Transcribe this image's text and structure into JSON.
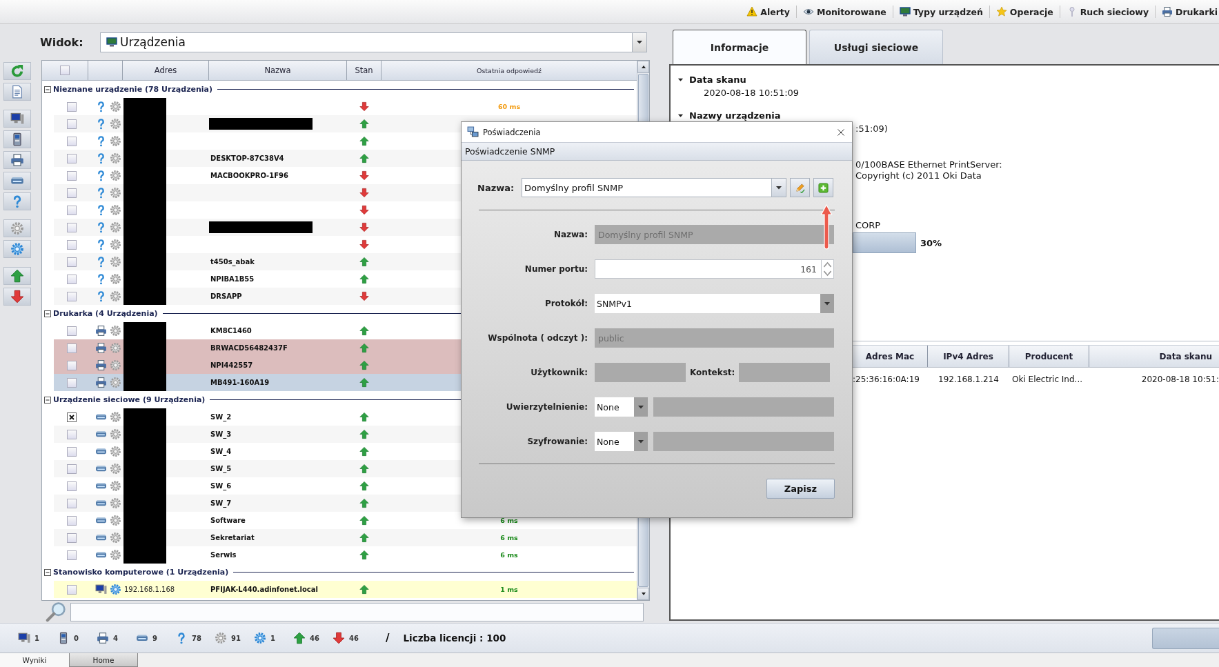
{
  "menu": [
    {
      "kind": "alerts",
      "label": "Alerty"
    },
    {
      "kind": "monitored",
      "label": "Monitorowane"
    },
    {
      "kind": "device_types",
      "label": "Typy urządzeń"
    },
    {
      "kind": "operations",
      "label": "Operacje"
    },
    {
      "kind": "traffic",
      "label": "Ruch sieciowy"
    },
    {
      "kind": "printers",
      "label": "Drukarki"
    }
  ],
  "view": {
    "label": "Widok:",
    "value": "Urządzenia"
  },
  "toolbar": [
    {
      "kind": "refresh"
    },
    {
      "kind": "report"
    },
    {
      "kind": "computer"
    },
    {
      "kind": "phone"
    },
    {
      "kind": "printer"
    },
    {
      "kind": "network"
    },
    {
      "kind": "unknown"
    },
    {
      "kind": "gear"
    },
    {
      "kind": "gear_blue"
    },
    {
      "kind": "up"
    },
    {
      "kind": "down"
    }
  ],
  "table": {
    "select_all": {
      "checked": false
    },
    "columns": [
      "Adres",
      "Nazwa",
      "Stan",
      "Ostatnia odpowiedź"
    ],
    "groups": [
      {
        "title": "Nieznane urządzenie (78 Urządzenia)",
        "expanded": true,
        "kind": "unknown",
        "address_redacted": true,
        "rows": [
          {
            "checked": false,
            "selected": false,
            "flagged": false,
            "highlighted": false,
            "agent": false,
            "up": false,
            "response": "60 ms",
            "color": "#f39c12"
          },
          {
            "checked": false,
            "selected": false,
            "flagged": false,
            "highlighted": false,
            "agent": false,
            "name_redacted": true,
            "up": true
          },
          {
            "checked": false,
            "selected": false,
            "flagged": false,
            "highlighted": false,
            "agent": false,
            "up": true
          },
          {
            "checked": false,
            "selected": false,
            "flagged": false,
            "highlighted": false,
            "agent": false,
            "name": "DESKTOP-87C38V4",
            "up": true
          },
          {
            "checked": false,
            "selected": false,
            "flagged": false,
            "highlighted": false,
            "agent": false,
            "name": "MACBOOKPRO-1F96",
            "up": false
          },
          {
            "checked": false,
            "selected": false,
            "flagged": false,
            "highlighted": false,
            "agent": false,
            "up": false
          },
          {
            "checked": false,
            "selected": false,
            "flagged": false,
            "highlighted": false,
            "agent": false,
            "up": false
          },
          {
            "checked": false,
            "selected": false,
            "flagged": false,
            "highlighted": false,
            "agent": false,
            "name_redacted": true,
            "up": false
          },
          {
            "checked": false,
            "selected": false,
            "flagged": false,
            "highlighted": false,
            "agent": false,
            "up": false
          },
          {
            "checked": false,
            "selected": false,
            "flagged": false,
            "highlighted": false,
            "agent": false,
            "name": "t450s_abak",
            "up": true
          },
          {
            "checked": false,
            "selected": false,
            "flagged": false,
            "highlighted": false,
            "agent": false,
            "name": "NPIBA1B55",
            "up": true
          },
          {
            "checked": false,
            "selected": false,
            "flagged": false,
            "highlighted": false,
            "agent": false,
            "name": "DRSAPP",
            "up": false
          }
        ]
      },
      {
        "title": "Drukarka (4 Urządzenia)",
        "expanded": true,
        "kind": "printer",
        "address_redacted": true,
        "rows": [
          {
            "checked": false,
            "selected": false,
            "flagged": false,
            "highlighted": false,
            "agent": false,
            "name": "KM8C1460",
            "up": true
          },
          {
            "checked": false,
            "selected": false,
            "flagged": true,
            "highlighted": false,
            "agent": false,
            "name": "BRWACD56482437F",
            "up": true
          },
          {
            "checked": false,
            "selected": false,
            "flagged": true,
            "highlighted": false,
            "agent": false,
            "name": "NPI442557",
            "up": true
          },
          {
            "checked": false,
            "selected": true,
            "flagged": false,
            "highlighted": false,
            "agent": false,
            "name": "MB491-160A19",
            "up": true
          }
        ]
      },
      {
        "title": "Urządzenie sieciowe (9 Urządzenia)",
        "expanded": true,
        "kind": "network",
        "address_redacted": true,
        "rows": [
          {
            "checked": true,
            "selected": false,
            "flagged": false,
            "highlighted": false,
            "agent": false,
            "name": "SW_2",
            "up": true
          },
          {
            "checked": false,
            "selected": false,
            "flagged": false,
            "highlighted": false,
            "agent": false,
            "name": "SW_3",
            "up": true
          },
          {
            "checked": false,
            "selected": false,
            "flagged": false,
            "highlighted": false,
            "agent": false,
            "name": "SW_4",
            "up": true
          },
          {
            "checked": false,
            "selected": false,
            "flagged": false,
            "highlighted": false,
            "agent": false,
            "name": "SW_5",
            "up": true
          },
          {
            "checked": false,
            "selected": false,
            "flagged": false,
            "highlighted": false,
            "agent": false,
            "name": "SW_6",
            "up": true
          },
          {
            "checked": false,
            "selected": false,
            "flagged": false,
            "highlighted": false,
            "agent": false,
            "name": "SW_7",
            "up": true
          },
          {
            "checked": false,
            "selected": false,
            "flagged": false,
            "highlighted": false,
            "agent": false,
            "name": "Software",
            "up": true,
            "response": "6 ms",
            "color": "#1a8a1a"
          },
          {
            "checked": false,
            "selected": false,
            "flagged": false,
            "highlighted": false,
            "agent": false,
            "name": "Sekretariat",
            "up": true,
            "response": "6 ms",
            "color": "#1a8a1a"
          },
          {
            "checked": false,
            "selected": false,
            "flagged": false,
            "highlighted": false,
            "agent": false,
            "name": "Serwis",
            "up": true,
            "response": "6 ms",
            "color": "#1a8a1a"
          }
        ]
      },
      {
        "title": "Stanowisko komputerowe (1 Urządzenia)",
        "expanded": true,
        "kind": "computer",
        "address_redacted": false,
        "rows": [
          {
            "checked": false,
            "selected": false,
            "flagged": false,
            "highlighted": true,
            "agent": true,
            "address": "192.168.1.168",
            "name": "PFIJAK-L440.adinfonet.local",
            "up": true,
            "response": "1 ms",
            "color": "#1a8a1a"
          }
        ]
      }
    ]
  },
  "info": {
    "tabs": [
      {
        "label": "Informacje",
        "selected": true
      },
      {
        "label": "Usługi sieciowe",
        "selected": false
      }
    ],
    "sections": [
      {
        "title": "Data skanu",
        "expanded": true,
        "lines": [
          "2020-08-18 10:51:09"
        ]
      },
      {
        "title": "Nazwy urządzenia",
        "expanded": true
      }
    ],
    "fragments": [
      ":51:09)",
      "0/100BASE Ethernet PrintServer:",
      "Copyright (c) 2011 Oki Data",
      "CORP"
    ],
    "progress": {
      "label": "30%"
    },
    "details": {
      "columns": [
        "Adres Mac",
        "IPv4 Adres",
        "Producent",
        "Data skanu"
      ],
      "rows": [
        [
          ":25:36:16:0A:19",
          "192.168.1.214",
          "Oki Electric Ind...",
          "2020-08-18 10:51:"
        ]
      ]
    }
  },
  "status_bar": {
    "counts": [
      {
        "kind": "computer",
        "count": "1"
      },
      {
        "kind": "phone",
        "count": "0"
      },
      {
        "kind": "printer",
        "count": "4"
      },
      {
        "kind": "network",
        "count": "9"
      },
      {
        "kind": "unknown",
        "count": "78"
      },
      {
        "kind": "gear",
        "count": "91"
      },
      {
        "kind": "gear_blue",
        "count": "1"
      },
      {
        "kind": "up",
        "count": "46"
      },
      {
        "kind": "down",
        "count": "46"
      }
    ],
    "separator": "/",
    "license": "Liczba licencji : 100"
  },
  "bottom_tabs": [
    {
      "label": "Wyniki",
      "selected": true
    },
    {
      "label": "Home",
      "selected": false
    }
  ],
  "dialog": {
    "title": "Poświadczenia",
    "section": "Poświadczenie SNMP",
    "profile": {
      "label": "Nazwa:",
      "value": "Domyślny profil SNMP",
      "tools": [
        {
          "kind": "edit"
        },
        {
          "kind": "add"
        }
      ]
    },
    "fields": [
      {
        "kind": "text",
        "label": "Nazwa:",
        "value": "Domyślny profil SNMP",
        "disabled": true
      },
      {
        "kind": "spinner",
        "label": "Numer portu:",
        "value": "161",
        "disabled": false
      },
      {
        "kind": "select",
        "label": "Protokół:",
        "value": "SNMPv1",
        "disabled": false
      },
      {
        "kind": "text",
        "label": "Wspólnota ( odczyt ):",
        "value": "public",
        "disabled": true
      },
      {
        "kind": "pair",
        "label": "Użytkownik:",
        "second_label": "Kontekst:",
        "disabled": true
      },
      {
        "kind": "select_text",
        "label": "Uwierzytelnienie:",
        "value": "None",
        "disabled": true
      },
      {
        "kind": "select_text",
        "label": "Szyfrowanie:",
        "value": "None",
        "disabled": true
      }
    ],
    "buttons": [
      "Zapisz"
    ],
    "annotations": [
      {
        "kind": "arrow"
      }
    ]
  }
}
